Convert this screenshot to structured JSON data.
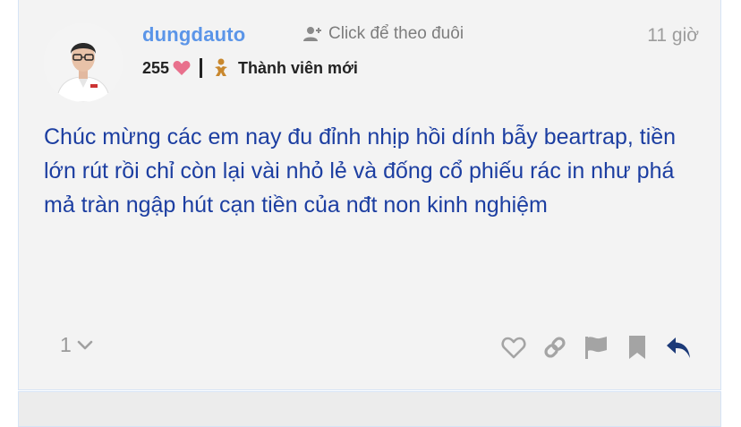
{
  "post": {
    "author": {
      "username": "dungdauto",
      "likes": "255",
      "rank": "Thành viên mới"
    },
    "follow_label": "Click để theo đuôi",
    "time": "11 giờ",
    "content": "Chúc mừng các em nay đu đỉnh nhịp hồi dính bẫy beartrap, tiền lớn rút rồi chỉ còn lại vài nhỏ lẻ và đống cổ phiếu rác in như phá mả tràn ngập hút cạn tiền của nđt non kinh nghiệm",
    "reply_count": "1",
    "actions": [
      "heart-icon",
      "link-icon",
      "flag-icon",
      "bookmark-icon",
      "reply-icon"
    ]
  },
  "colors": {
    "username": "#5b95e8",
    "content": "#1c3ea1",
    "heart": "#e8708c",
    "rank_icon": "#c9882e",
    "reply_action": "#1c3a78"
  }
}
